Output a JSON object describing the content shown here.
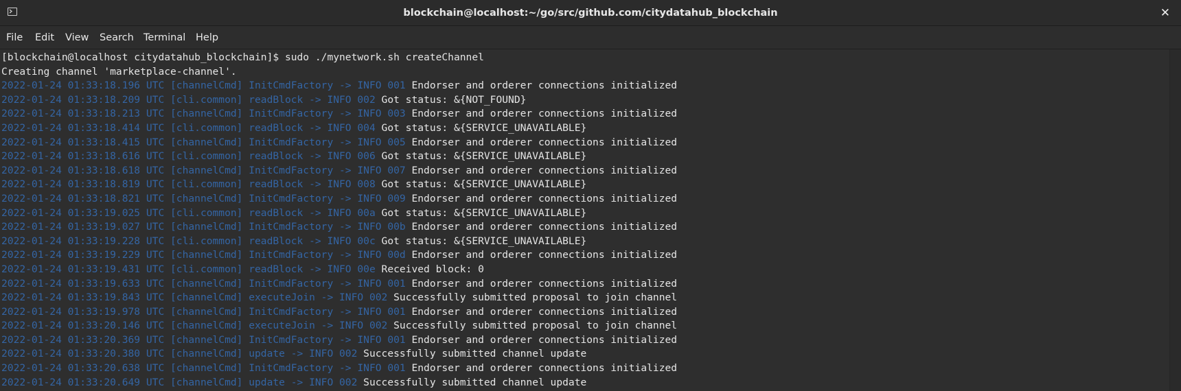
{
  "window": {
    "title": "blockchain@localhost:~/go/src/github.com/citydatahub_blockchain",
    "close_glyph": "✕",
    "icon": "terminal-icon"
  },
  "menu": [
    {
      "id": "file",
      "label": "File"
    },
    {
      "id": "edit",
      "label": "Edit"
    },
    {
      "id": "view",
      "label": "View"
    },
    {
      "id": "search",
      "label": "Search"
    },
    {
      "id": "terminal",
      "label": "Terminal"
    },
    {
      "id": "help",
      "label": "Help"
    }
  ],
  "colors": {
    "log_prefix": "#3465a4",
    "text": "#e5e5e5",
    "background": "#2e2e2e"
  },
  "terminal": {
    "prompt_line": "[blockchain@localhost citydatahub_blockchain]$ sudo ./mynetwork.sh createChannel",
    "status_line": "Creating channel 'marketplace-channel'.",
    "logs": [
      {
        "prefix": "2022-01-24 01:33:18.196 UTC [channelCmd] InitCmdFactory -> INFO 001",
        "message": " Endorser and orderer connections initialized"
      },
      {
        "prefix": "2022-01-24 01:33:18.209 UTC [cli.common] readBlock -> INFO 002",
        "message": " Got status: &{NOT_FOUND}"
      },
      {
        "prefix": "2022-01-24 01:33:18.213 UTC [channelCmd] InitCmdFactory -> INFO 003",
        "message": " Endorser and orderer connections initialized"
      },
      {
        "prefix": "2022-01-24 01:33:18.414 UTC [cli.common] readBlock -> INFO 004",
        "message": " Got status: &{SERVICE_UNAVAILABLE}"
      },
      {
        "prefix": "2022-01-24 01:33:18.415 UTC [channelCmd] InitCmdFactory -> INFO 005",
        "message": " Endorser and orderer connections initialized"
      },
      {
        "prefix": "2022-01-24 01:33:18.616 UTC [cli.common] readBlock -> INFO 006",
        "message": " Got status: &{SERVICE_UNAVAILABLE}"
      },
      {
        "prefix": "2022-01-24 01:33:18.618 UTC [channelCmd] InitCmdFactory -> INFO 007",
        "message": " Endorser and orderer connections initialized"
      },
      {
        "prefix": "2022-01-24 01:33:18.819 UTC [cli.common] readBlock -> INFO 008",
        "message": " Got status: &{SERVICE_UNAVAILABLE}"
      },
      {
        "prefix": "2022-01-24 01:33:18.821 UTC [channelCmd] InitCmdFactory -> INFO 009",
        "message": " Endorser and orderer connections initialized"
      },
      {
        "prefix": "2022-01-24 01:33:19.025 UTC [cli.common] readBlock -> INFO 00a",
        "message": " Got status: &{SERVICE_UNAVAILABLE}"
      },
      {
        "prefix": "2022-01-24 01:33:19.027 UTC [channelCmd] InitCmdFactory -> INFO 00b",
        "message": " Endorser and orderer connections initialized"
      },
      {
        "prefix": "2022-01-24 01:33:19.228 UTC [cli.common] readBlock -> INFO 00c",
        "message": " Got status: &{SERVICE_UNAVAILABLE}"
      },
      {
        "prefix": "2022-01-24 01:33:19.229 UTC [channelCmd] InitCmdFactory -> INFO 00d",
        "message": " Endorser and orderer connections initialized"
      },
      {
        "prefix": "2022-01-24 01:33:19.431 UTC [cli.common] readBlock -> INFO 00e",
        "message": " Received block: 0"
      },
      {
        "prefix": "2022-01-24 01:33:19.633 UTC [channelCmd] InitCmdFactory -> INFO 001",
        "message": " Endorser and orderer connections initialized"
      },
      {
        "prefix": "2022-01-24 01:33:19.843 UTC [channelCmd] executeJoin -> INFO 002",
        "message": " Successfully submitted proposal to join channel"
      },
      {
        "prefix": "2022-01-24 01:33:19.978 UTC [channelCmd] InitCmdFactory -> INFO 001",
        "message": " Endorser and orderer connections initialized"
      },
      {
        "prefix": "2022-01-24 01:33:20.146 UTC [channelCmd] executeJoin -> INFO 002",
        "message": " Successfully submitted proposal to join channel"
      },
      {
        "prefix": "2022-01-24 01:33:20.369 UTC [channelCmd] InitCmdFactory -> INFO 001",
        "message": " Endorser and orderer connections initialized"
      },
      {
        "prefix": "2022-01-24 01:33:20.380 UTC [channelCmd] update -> INFO 002",
        "message": " Successfully submitted channel update"
      },
      {
        "prefix": "2022-01-24 01:33:20.638 UTC [channelCmd] InitCmdFactory -> INFO 001",
        "message": " Endorser and orderer connections initialized"
      },
      {
        "prefix": "2022-01-24 01:33:20.649 UTC [channelCmd] update -> INFO 002",
        "message": " Successfully submitted channel update"
      }
    ]
  }
}
